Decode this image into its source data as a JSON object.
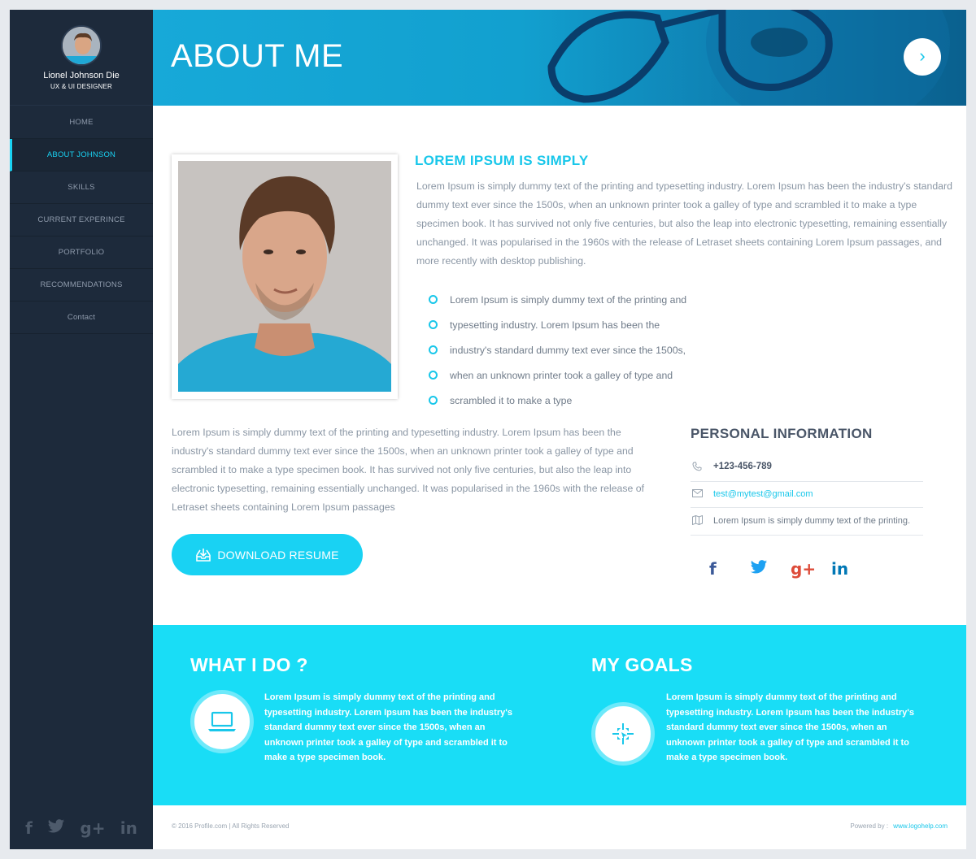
{
  "sidebar": {
    "name": "Lionel Johnson Die",
    "role": "UX & UI DESIGNER",
    "items": [
      {
        "label": "HOME",
        "active": false
      },
      {
        "label": "ABOUT JOHNSON",
        "active": true
      },
      {
        "label": "SKILLS",
        "active": false
      },
      {
        "label": "CURRENT EXPERINCE",
        "active": false
      },
      {
        "label": "PORTFOLIO",
        "active": false
      },
      {
        "label": "RECOMMENDATIONS",
        "active": false
      },
      {
        "label": "Contact",
        "active": false
      }
    ],
    "social_icons": [
      "facebook-icon",
      "twitter-icon",
      "google-plus-icon",
      "linkedin-icon"
    ]
  },
  "header": {
    "title": "ABOUT ME",
    "next_icon": "›"
  },
  "intro": {
    "title": "LOREM IPSUM IS SIMPLY",
    "text": "Lorem Ipsum is simply dummy text of the printing and typesetting industry. Lorem Ipsum has been the industry's standard dummy text ever since the 1500s, when an unknown printer took a galley of type and scrambled it to make a type specimen book. It has survived not only five centuries, but also the leap into electronic typesetting, remaining essentially unchanged. It was popularised in the 1960s with the release of Letraset sheets containing Lorem Ipsum passages, and more recently with desktop publishing.",
    "bullets": [
      "Lorem Ipsum is simply dummy text of the printing and",
      "typesetting industry. Lorem Ipsum has been the",
      "industry's standard dummy text ever since the 1500s,",
      "when an unknown printer took a galley of type and",
      "scrambled it to make a type"
    ]
  },
  "body": {
    "text": "Lorem Ipsum is simply dummy text of the printing and typesetting industry. Lorem Ipsum has been the industry's standard dummy text ever since the 1500s, when an unknown printer took a galley of type and scrambled it to make a type specimen book. It has survived not only five centuries, but also the leap into electronic typesetting, remaining essentially unchanged. It was popularised in the 1960s with the release of Letraset sheets containing Lorem Ipsum passages",
    "download_label": "DOWNLOAD RESUME"
  },
  "personal": {
    "title": "PERSONAL INFORMATION",
    "phone": "+123-456-789",
    "email": "test@mytest@gmail.com",
    "address": "Lorem Ipsum is simply dummy text of the printing.",
    "social": [
      {
        "icon": "facebook-icon",
        "glyph": "f",
        "color": "#3b5998"
      },
      {
        "icon": "twitter-icon",
        "glyph": "🐦",
        "color": "#1da1f2"
      },
      {
        "icon": "google-plus-icon",
        "glyph": "g+",
        "color": "#dd4b39"
      },
      {
        "icon": "linkedin-icon",
        "glyph": "in",
        "color": "#0077b5"
      }
    ]
  },
  "band": {
    "what_title": "WHAT I DO ?",
    "what_text": "Lorem Ipsum is simply dummy text of the printing and typesetting industry. Lorem Ipsum has been the industry's standard dummy text ever since the 1500s, when an unknown printer took a galley of type and scrambled it to make a type specimen book.",
    "goals_title": "MY GOALS",
    "goals_text": "Lorem Ipsum is simply dummy text of the printing and typesetting industry. Lorem Ipsum has been the industry's standard dummy text ever since the 1500s, when an unknown printer took a galley of type and scrambled it to make a type specimen book."
  },
  "footer": {
    "copyright": "© 2016 Profile.com | All Rights Reserved",
    "powered_label": "Powered by :",
    "powered_link": "www.logohelp.com"
  },
  "colors": {
    "accent": "#19d2f3",
    "sidebar": "#1d2a3b",
    "header": "#17a9d8"
  }
}
